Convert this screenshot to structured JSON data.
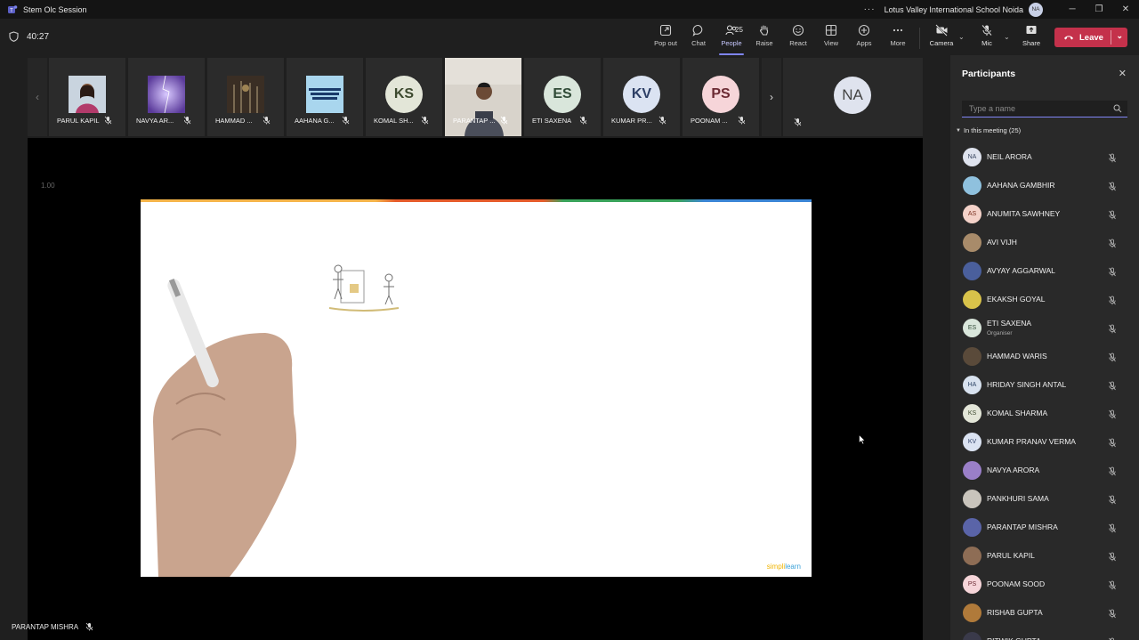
{
  "window": {
    "title": "Stem Olc Session",
    "organization": "Lotus Valley International School Noida",
    "user_initials": "NA",
    "more_dots": "···",
    "controls": {
      "minimize": "─",
      "restore": "❐",
      "close": "✕"
    }
  },
  "toolbar": {
    "timer": "40:27",
    "items": [
      {
        "label": "Pop out",
        "icon": "pop-out-icon"
      },
      {
        "label": "Chat",
        "icon": "chat-icon"
      },
      {
        "label": "People",
        "icon": "people-icon",
        "count": "25",
        "active": true
      },
      {
        "label": "Raise",
        "icon": "hand-icon"
      },
      {
        "label": "React",
        "icon": "smile-icon"
      },
      {
        "label": "View",
        "icon": "grid-icon"
      },
      {
        "label": "Apps",
        "icon": "apps-icon"
      },
      {
        "label": "More",
        "icon": "more-icon"
      }
    ],
    "camera_label": "Camera",
    "mic_label": "Mic",
    "share_label": "Share",
    "leave_label": "Leave",
    "caret": "⌄"
  },
  "tiles": [
    {
      "name": "PARUL KAPIL",
      "kind": "photo",
      "color": "#b8a38f"
    },
    {
      "name": "NAVYA AR...",
      "kind": "photo",
      "color": "#8a6fb8"
    },
    {
      "name": "HAMMAD ...",
      "kind": "photo",
      "color": "#5a4a3a"
    },
    {
      "name": "AAHANA G...",
      "kind": "photo",
      "color": "#9fcde8"
    },
    {
      "name": "KOMAL SH...",
      "kind": "initials",
      "initials": "KS",
      "bg": "#e3e6d8",
      "fg": "#3d4a2f"
    },
    {
      "name": "PARANTAP ...",
      "kind": "video",
      "color": "#d9d4cc"
    },
    {
      "name": "ETI SAXENA",
      "kind": "initials",
      "initials": "ES",
      "bg": "#d9e6db",
      "fg": "#2f4a36"
    },
    {
      "name": "KUMAR PR...",
      "kind": "initials",
      "initials": "KV",
      "bg": "#dbe3f2",
      "fg": "#2d3f66"
    },
    {
      "name": "POONAM ...",
      "kind": "initials",
      "initials": "PS",
      "bg": "#f6d5d9",
      "fg": "#6b2a33"
    }
  ],
  "big_tile": {
    "initials": "NA"
  },
  "stage": {
    "zoom": "1.00",
    "speaker": "PARANTAP MISHRA",
    "slide_brand_a": "simpli",
    "slide_brand_b": "learn"
  },
  "panel": {
    "title": "Participants",
    "search_placeholder": "Type a name",
    "section_label": "In this meeting (25)",
    "participants": [
      {
        "name": "NEIL ARORA",
        "initials": "NA",
        "bg": "#dfe3ee",
        "fg": "#3a4660"
      },
      {
        "name": "AAHANA GAMBHIR",
        "photo": "#8fc1de"
      },
      {
        "name": "ANUMITA SAWHNEY",
        "initials": "AS",
        "bg": "#f4d2c9",
        "fg": "#7a3020"
      },
      {
        "name": "AVI VIJH",
        "photo": "#a88b6a"
      },
      {
        "name": "AVYAY AGGARWAL",
        "photo": "#4a5f9c"
      },
      {
        "name": "EKAKSH GOYAL",
        "photo": "#d8c24a"
      },
      {
        "name": "ETI SAXENA",
        "initials": "ES",
        "bg": "#d9e6db",
        "fg": "#2f4a36",
        "role": "Organiser"
      },
      {
        "name": "HAMMAD WARIS",
        "photo": "#5a4a3a"
      },
      {
        "name": "HRIDAY SINGH ANTAL",
        "initials": "HA",
        "bg": "#d8e2ef",
        "fg": "#2d4566"
      },
      {
        "name": "KOMAL SHARMA",
        "initials": "KS",
        "bg": "#e3e6d8",
        "fg": "#3d4a2f"
      },
      {
        "name": "KUMAR PRANAV VERMA",
        "initials": "KV",
        "bg": "#dbe3f2",
        "fg": "#2d3f66"
      },
      {
        "name": "NAVYA ARORA",
        "photo": "#9a7fc8"
      },
      {
        "name": "PANKHURI SAMA",
        "photo": "#c9c4bc"
      },
      {
        "name": "PARANTAP MISHRA",
        "photo": "#5a64a8"
      },
      {
        "name": "PARUL KAPIL",
        "photo": "#8e6d55"
      },
      {
        "name": "POONAM SOOD",
        "initials": "PS",
        "bg": "#f6d5d9",
        "fg": "#6b2a33"
      },
      {
        "name": "RISHAB GUPTA",
        "photo": "#b07a3a"
      },
      {
        "name": "RITWIK GUPTA",
        "photo": "#3a3a4a"
      }
    ]
  },
  "colors": {
    "accent": "#7f85f5",
    "leave": "#c4314b",
    "panel": "#292929",
    "stage": "#1f1f1f"
  }
}
